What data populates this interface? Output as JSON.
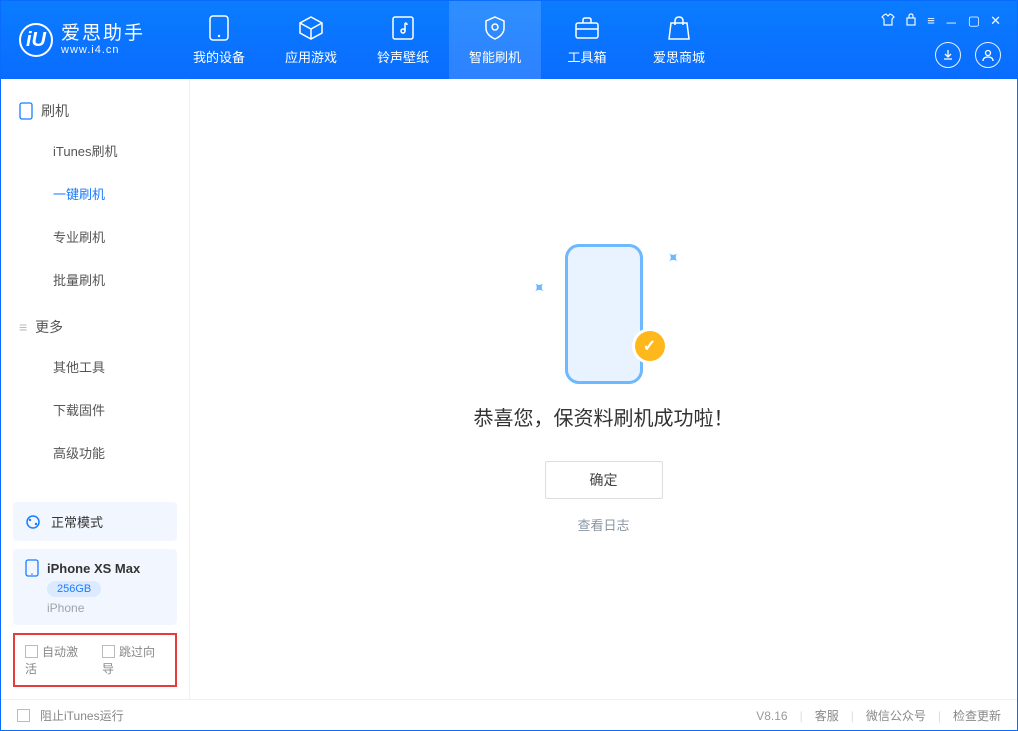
{
  "header": {
    "logo_title": "爱思助手",
    "logo_sub": "www.i4.cn",
    "tabs": [
      {
        "label": "我的设备"
      },
      {
        "label": "应用游戏"
      },
      {
        "label": "铃声壁纸"
      },
      {
        "label": "智能刷机"
      },
      {
        "label": "工具箱"
      },
      {
        "label": "爱思商城"
      }
    ]
  },
  "sidebar": {
    "group1_title": "刷机",
    "items1": [
      {
        "label": "iTunes刷机"
      },
      {
        "label": "一键刷机"
      },
      {
        "label": "专业刷机"
      },
      {
        "label": "批量刷机"
      }
    ],
    "group2_title": "更多",
    "items2": [
      {
        "label": "其他工具"
      },
      {
        "label": "下载固件"
      },
      {
        "label": "高级功能"
      }
    ],
    "mode_label": "正常模式",
    "device_name": "iPhone XS Max",
    "device_capacity": "256GB",
    "device_type": "iPhone",
    "checks": {
      "auto_activate": "自动激活",
      "skip_wizard": "跳过向导"
    }
  },
  "main": {
    "success_text": "恭喜您，保资料刷机成功啦！",
    "ok_button": "确定",
    "view_log": "查看日志"
  },
  "footer": {
    "block_itunes": "阻止iTunes运行",
    "version": "V8.16",
    "links": [
      "客服",
      "微信公众号",
      "检查更新"
    ]
  }
}
